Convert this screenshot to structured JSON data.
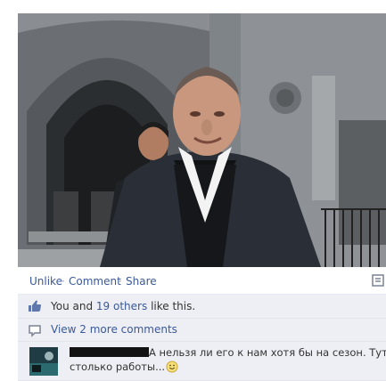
{
  "post": {
    "photo": {
      "icon": "photo",
      "alt": ""
    },
    "actions": {
      "unlike": "Unlike",
      "comment": "Comment",
      "share": "Share",
      "separator": "·"
    },
    "likes": {
      "you": "You",
      "and": "and",
      "others": "19 others",
      "like_this": "like this."
    },
    "more_comments": "View 2 more comments",
    "comment": {
      "text_line1": "А нельзя ли его к нам хотя бы на сезон. Тут",
      "text_line2": "столько работы...",
      "emoji": "smiley-icon"
    }
  }
}
